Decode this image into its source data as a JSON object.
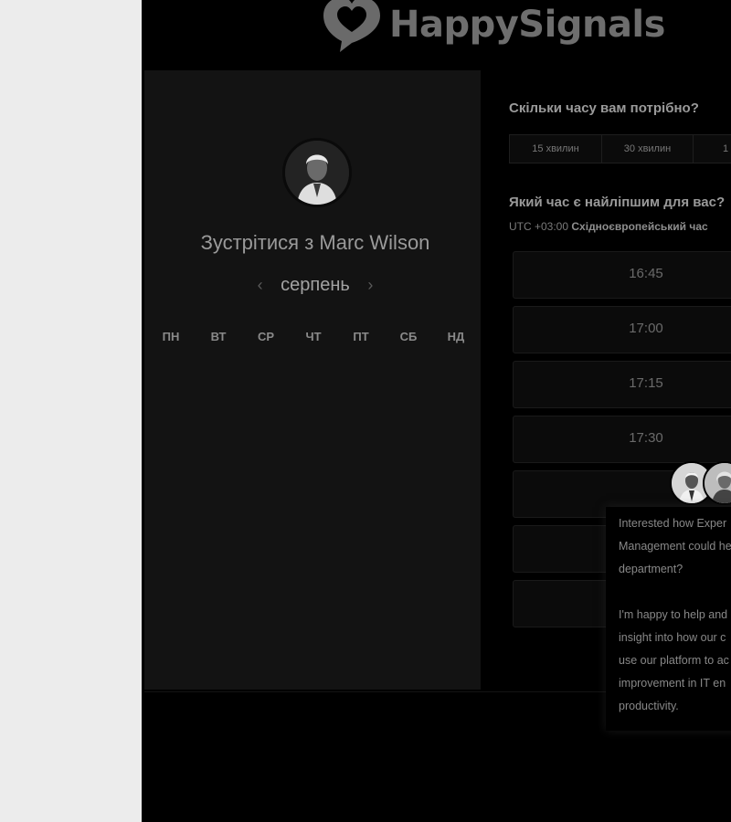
{
  "brand": {
    "logo_text": "HappySignals"
  },
  "booking": {
    "meet_prefix": "Зустрітися з",
    "host_name": "Marc Wilson",
    "month": "серпень",
    "prev_icon": "‹",
    "next_icon": "›",
    "weekdays": [
      "ПН",
      "ВТ",
      "СР",
      "ЧТ",
      "ПТ",
      "СБ",
      "НД"
    ]
  },
  "durations": {
    "question": "Скільки часу вам потрібно?",
    "options": [
      "15 хвилин",
      "30 хвилин",
      "1"
    ]
  },
  "times": {
    "question": "Який час є найліпшим для вас?",
    "timezone_offset": "UTC +03:00",
    "timezone_name": "Східноєвропейський час",
    "slots": [
      "16:45",
      "17:00",
      "17:15",
      "17:30",
      "",
      "",
      ""
    ]
  },
  "chat": {
    "paragraph1": [
      "Interested how Exper",
      "Management could he",
      "department?"
    ],
    "paragraph2": [
      "I'm happy to help and",
      "insight into how our c",
      "use our platform to ac",
      "improvement in IT en",
      "productivity."
    ]
  }
}
